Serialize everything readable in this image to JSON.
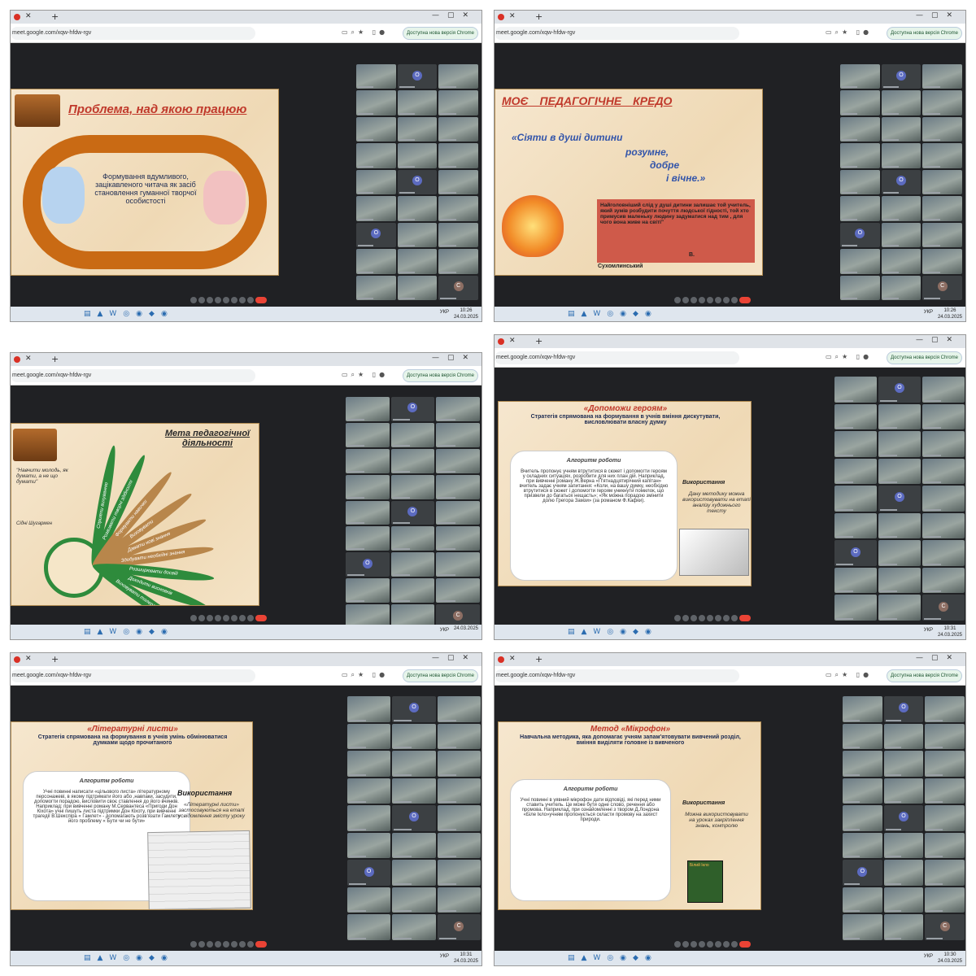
{
  "browser": {
    "url": "meet.google.com/xqw-hfdw-rgv",
    "update_button": "Доступна нова версія Chrome",
    "lang": "УКР",
    "date": "24.03.2025"
  },
  "shots": [
    {
      "time": "10:26",
      "slide": {
        "title": "Проблема, над якою працюю",
        "body": "Формування вдумливого, зацікавленого читача як засіб становлення гуманної творчої особистості"
      }
    },
    {
      "time": "10:26",
      "slide": {
        "title": "МОЄ ПЕДАГОГІЧНЕ КРЕДО",
        "quote_l1": "«Сіяти в душі дитини",
        "quote_l2": "розумне,",
        "quote_l3": "добре",
        "quote_l4": "і вічне.»",
        "box": "Найголовніший слід у душі дитини залишає той учитель, який зумів розбудити почуття людської гідності, той хто примусив маленьку людину задуматися над тим , для чого вона живе на світі\"",
        "author_initial": "В.",
        "author": "Сухомлинський"
      }
    },
    {
      "time": "",
      "slide": {
        "title": "Мета педагогічної діяльності",
        "quote": "\"Навчити молодь, як думати, а не що думати\"",
        "quote_author": "Сідні Шугармен",
        "petals": [
          "Сприяти вихуванню",
          "Розвивати творчі здібності",
          "Формувати навички",
          "Виховувати",
          "Давати нові знання",
          "Здобувати необхідні знання",
          "Розширювати досвід",
          "Доходити висновків",
          "Виховувати толерантність"
        ]
      }
    },
    {
      "time": "10:31",
      "slide": {
        "title": "«Допоможи героям»",
        "subtitle": "Стратегія спрямована на формування в учнів вміння дискутувати, висловлювати власну думку",
        "algo_title": "Алгоритм роботи",
        "algo_text": "Вчитель пропонує учням втрутитися в сюжет і допомогти героям у складних ситуаціях, розробити для них план дій. Наприклад, при вивченні роману Ж.Верна «П'ятнадцятирічний капітан» вчитель задає учням запитання: «Коли, на вашу думку, необхідно втрутитися в сюжет і допомогти героям уникнути помилок, що призвели до багатьох нещасть»; «Як можна порадою змінити долю Грегора Замзи» (за романом Ф.Кафки).",
        "usage_title": "Використання",
        "usage_text": "Дану методику можна використовувати на етапі аналізу художнього тексту"
      }
    },
    {
      "time": "10:31",
      "slide": {
        "title": "«Літературні листи»",
        "subtitle": "Стратегія спрямована на формування в учнів умінь обмінюватися думками щодо прочитаного",
        "algo_title": "Алгоритм роботи",
        "algo_text": "Учні повинні написати «цільового листа» літературному персонажеві, в якому підтримати його або ,навпаки, засудити, допомогти порадою, висловити своє ставлення до його вчинків. Наприклад: при вивченні роману М.Сервантеса «Пригоди Дон Кіхота» учні пишуть листа підтримки Дон Кіхоту, при вивченні трагедії В.Шекспіра « Гамлет» - допомагають розв'язати Гамлету його проблему « Бути чи не бути»",
        "usage_title": "Використання",
        "usage_text": "«Літературні листи» застосовуються на етапі усвідомлення змісту уроку"
      }
    },
    {
      "time": "10:30",
      "slide": {
        "title": "Метод «Мікрофон»",
        "subtitle": "Навчальна методика, яка допомагає учням запам'ятовувати вивчений розділ, вміння виділяти головне із вивченого",
        "algo_title": "Алгоритм роботи",
        "algo_text": "Учні повинні в уявний мікрофон дати відповіді, які перед ними ставить учитель. Це може бути одне слово, речення або промова. Наприклад, при ознайомленні з твором Д.Лондона «Біле Ікло»учням пропонується скласти промову на захист природи.",
        "usage_title": "Використання",
        "usage_text": "Можна використовувати на уроках закріплення знань, контролю",
        "book_title": "Білий Ікло"
      }
    }
  ]
}
